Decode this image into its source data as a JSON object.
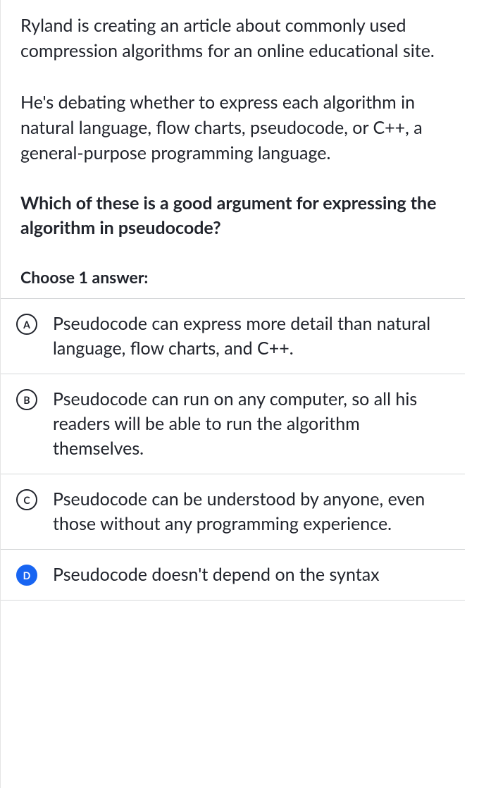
{
  "question": {
    "paragraph1": "Ryland is creating an article about commonly used compression algorithms for an online educational site.",
    "paragraph2": "He's debating whether to express each algorithm in natural language, flow charts, pseudocode, or C++, a general-purpose programming language.",
    "prompt": "Which of these is a good argument for expressing the algorithm in pseudocode?"
  },
  "choose_label": "Choose 1 answer:",
  "options": [
    {
      "letter": "A",
      "text": "Pseudocode can express more detail than natural language, flow charts, and C++.",
      "selected": false
    },
    {
      "letter": "B",
      "text": "Pseudocode can run on any computer, so all his readers will be able to run the algorithm themselves.",
      "selected": false
    },
    {
      "letter": "C",
      "text": "Pseudocode can be understood by anyone, even those without any programming experience.",
      "selected": false
    },
    {
      "letter": "D",
      "text": "Pseudocode doesn't depend on the syntax",
      "selected": true
    }
  ]
}
